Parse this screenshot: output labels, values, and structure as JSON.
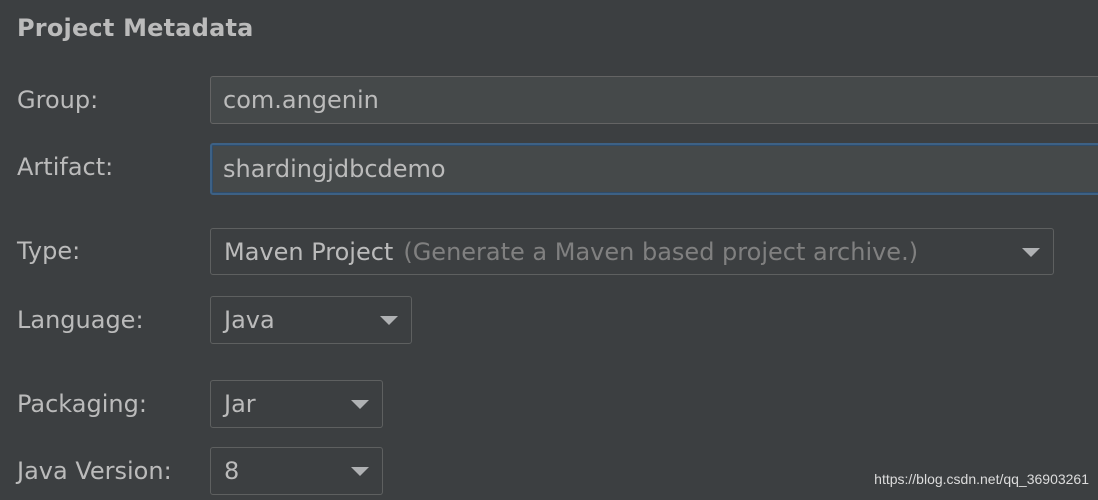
{
  "section": {
    "title": "Project Metadata"
  },
  "fields": {
    "group": {
      "label": "Group:",
      "value": "com.angenin"
    },
    "artifact": {
      "label": "Artifact:",
      "value": "shardingjdbcdemo"
    },
    "type": {
      "label": "Type:",
      "value": "Maven Project",
      "hint": "(Generate a Maven based project archive.)"
    },
    "language": {
      "label": "Language:",
      "value": "Java"
    },
    "packaging": {
      "label": "Packaging:",
      "value": "Jar"
    },
    "java_version": {
      "label": "Java Version:",
      "value": "8"
    }
  },
  "watermark": "https://blog.csdn.net/qq_36903261",
  "colors": {
    "background": "#3c3f41",
    "text": "#bbbbbb",
    "hint_text": "#808080",
    "input_background": "#45494a",
    "focus_border": "#3d6185"
  },
  "icons": {
    "dropdown": "chevron-down-icon"
  }
}
